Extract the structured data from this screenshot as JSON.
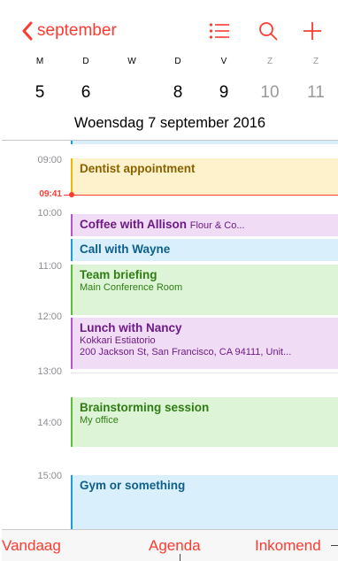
{
  "nav": {
    "back_label": "september",
    "list_icon": "list-icon",
    "search_icon": "search-icon",
    "add_icon": "plus-icon",
    "accent_color": "#ff3b30"
  },
  "week": {
    "days": [
      "M",
      "D",
      "W",
      "D",
      "V",
      "Z",
      "Z"
    ],
    "dates": [
      "5",
      "6",
      "7",
      "8",
      "9",
      "10",
      "11"
    ],
    "selected_index": 2
  },
  "day_title": "Woensdag  7 september 2016",
  "timeline": {
    "hours": [
      "09:00",
      "10:00",
      "11:00",
      "12:00",
      "13:00",
      "14:00",
      "15:00"
    ],
    "now_label": "09:41"
  },
  "events": [
    {
      "title": "Dentist appointment",
      "subtitle": "",
      "color": "yellow"
    },
    {
      "title": "Coffee with Allison",
      "inline": "Flour & Co...",
      "color": "purple"
    },
    {
      "title": "Call with Wayne",
      "subtitle": "",
      "color": "blue"
    },
    {
      "title": "Team briefing",
      "subtitle": "Main Conference Room",
      "color": "green"
    },
    {
      "title": "Lunch with Nancy",
      "subtitle": "Kokkari Estiatorio",
      "subtitle2": "200 Jackson St, San Francisco, CA  94111, Unit...",
      "color": "purple"
    },
    {
      "title": "Brainstorming session",
      "subtitle": "My office",
      "color": "green"
    },
    {
      "title": "Gym or something",
      "subtitle": "",
      "color": "blue"
    }
  ],
  "toolbar": {
    "today_label": "Vandaag",
    "agenda_label": "Agenda",
    "inbox_label": "Inkomend"
  }
}
